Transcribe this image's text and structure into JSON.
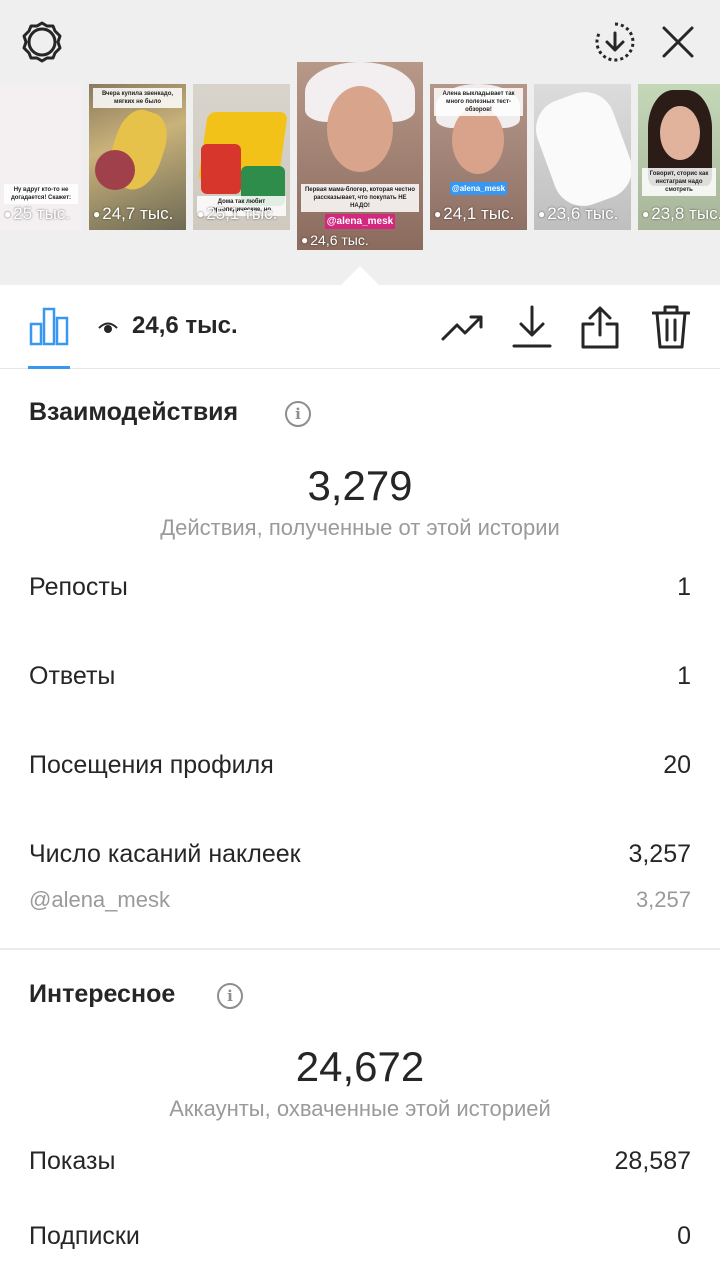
{
  "header": {
    "settings_icon": "gear-icon",
    "download_icon": "download-circle-icon",
    "close_icon": "close-icon"
  },
  "stories": [
    {
      "views": "25 тыс.",
      "caption": "Ну вдруг кто-то не догадается! Скажет:"
    },
    {
      "views": "24,7 тыс.",
      "caption": "Вчера купила звенкадо, мягких не было"
    },
    {
      "views": "25,1 тыс.",
      "caption": "Дома так любит ортопедические, но"
    },
    {
      "views": "24,6 тыс.",
      "caption": "Первая мама-блогер, которая честно рассказывает, что покупать НЕ НАДО!",
      "tag": "@alena_mesk",
      "active": true
    },
    {
      "views": "24,1 тыс.",
      "caption": "Алена выкладывает так много полезных тест-обзоров!",
      "tag": "@alena_mesk"
    },
    {
      "views": "23,6 тыс.",
      "caption": ""
    },
    {
      "views": "23,8 тыс.",
      "caption": "Говорит, сторис как инстаграм надо смотреть"
    }
  ],
  "toolbar": {
    "views_value": "24,6 тыс.",
    "icons": [
      "bar-chart-icon",
      "eye-icon",
      "trend-icon",
      "download-icon",
      "share-icon",
      "trash-icon"
    ]
  },
  "interactions": {
    "title": "Взаимодействия",
    "total": "3,279",
    "total_label": "Действия, полученные от этой истории",
    "rows": [
      {
        "label": "Репосты",
        "value": "1"
      },
      {
        "label": "Ответы",
        "value": "1"
      },
      {
        "label": "Посещения профиля",
        "value": "20"
      },
      {
        "label": "Число касаний наклеек",
        "value": "3,257"
      }
    ],
    "sub_row": {
      "label": "@alena_mesk",
      "value": "3,257"
    }
  },
  "discovery": {
    "title": "Интересное",
    "total": "24,672",
    "total_label": "Аккаунты, охваченные этой историей",
    "rows": [
      {
        "label": "Показы",
        "value": "28,587"
      },
      {
        "label": "Подписки",
        "value": "0"
      }
    ]
  },
  "colors": {
    "accent": "#3897f0",
    "tag": "#d3287d",
    "muted": "#9a9a9a",
    "text": "#262626"
  }
}
